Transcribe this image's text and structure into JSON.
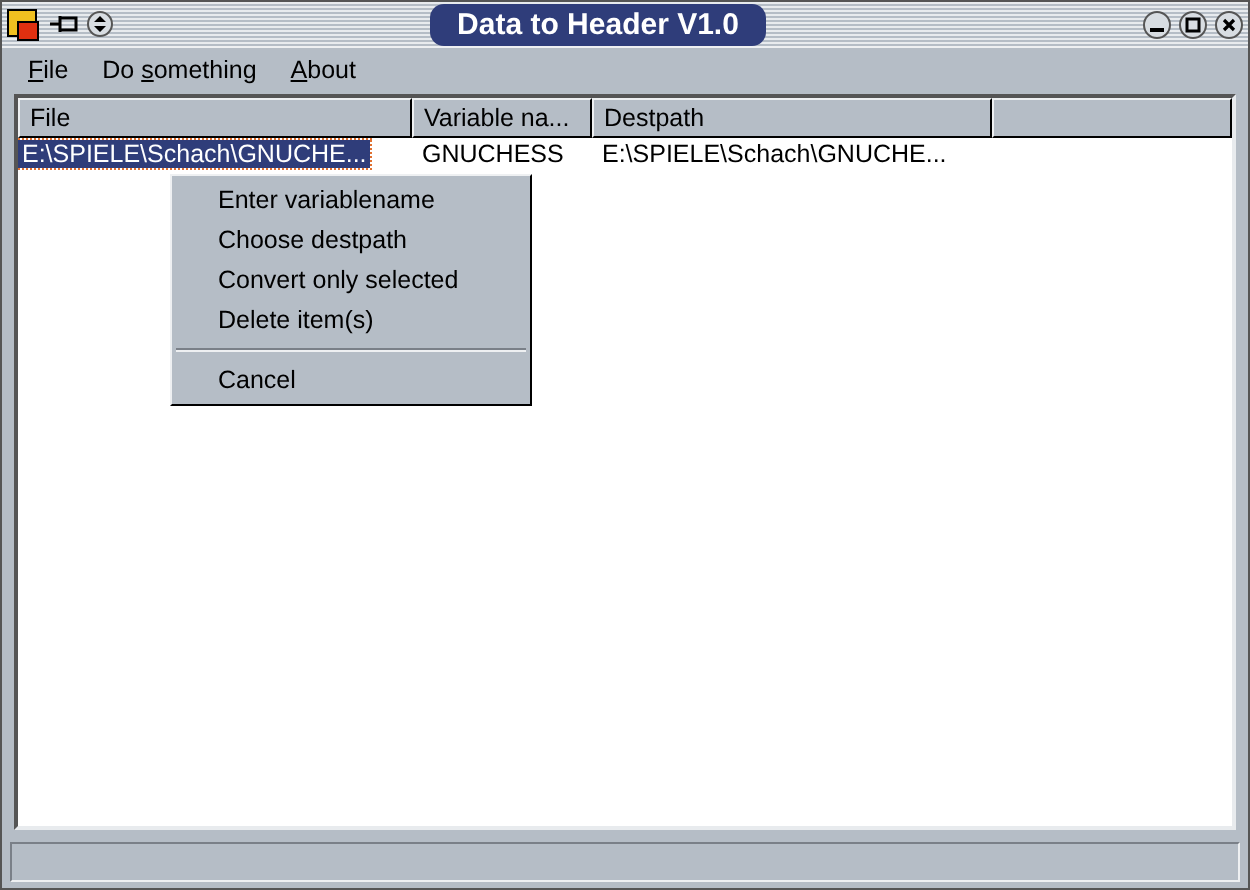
{
  "window": {
    "title": "Data to Header V1.0"
  },
  "menu_bar": [
    {
      "key": "F",
      "after": "ile"
    },
    {
      "before": "Do ",
      "key": "s",
      "after": "omething"
    },
    {
      "key": "A",
      "after": "bout"
    }
  ],
  "table": {
    "columns": [
      "File",
      "Variable na...",
      "Destpath"
    ],
    "rows": [
      {
        "selected": true,
        "cells": [
          "E:\\SPIELE\\Schach\\GNUCHE...",
          "GNUCHESS",
          "E:\\SPIELE\\Schach\\GNUCHE..."
        ]
      }
    ]
  },
  "context_menu": [
    {
      "kind": "item",
      "label": "Enter variablename"
    },
    {
      "kind": "item",
      "label": "Choose destpath"
    },
    {
      "kind": "item",
      "label": "Convert only selected"
    },
    {
      "kind": "item",
      "label": "Delete item(s)"
    },
    {
      "kind": "separator"
    },
    {
      "kind": "item",
      "label": "Cancel"
    }
  ]
}
